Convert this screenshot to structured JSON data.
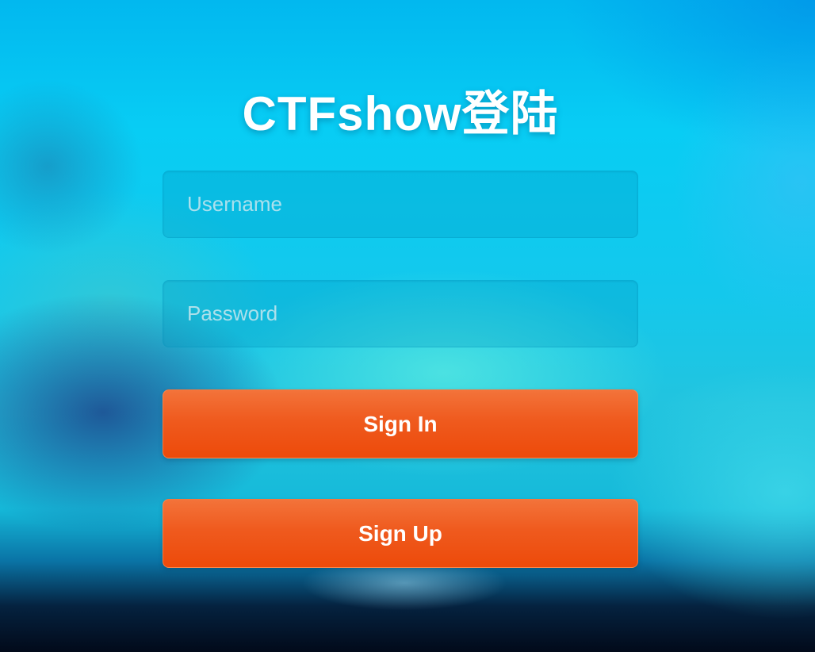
{
  "page": {
    "title": "CTFshow登陆"
  },
  "login_form": {
    "username": {
      "placeholder": "Username",
      "value": ""
    },
    "password": {
      "placeholder": "Password",
      "value": ""
    },
    "sign_in_label": "Sign In",
    "sign_up_label": "Sign Up"
  },
  "colors": {
    "button": "#ef5a1e",
    "background_top": "#02b8ef",
    "background_bottom": "#020a1a",
    "title_text": "#ffffff"
  }
}
